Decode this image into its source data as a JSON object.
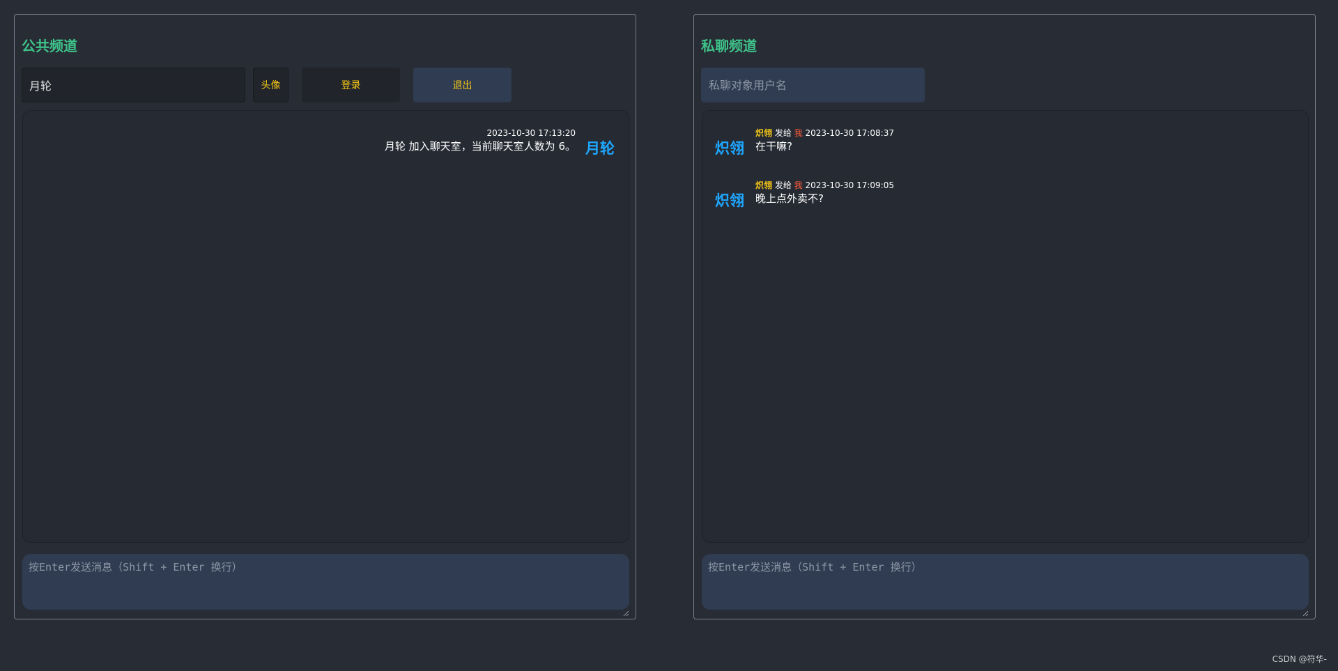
{
  "public_channel": {
    "title": "公共频道",
    "username_value": "月轮",
    "avatar_button": "头像",
    "login_button": "登录",
    "logout_button": "退出",
    "messages": [
      {
        "time": "2023-10-30 17:13:20",
        "text": "月轮 加入聊天室，当前聊天室人数为 6。",
        "avatar": "月轮"
      }
    ],
    "compose_placeholder": "按Enter发送消息（Shift + Enter 换行）"
  },
  "private_channel": {
    "title": "私聊频道",
    "recipient_placeholder": "私聊对象用户名",
    "messages": [
      {
        "avatar": "炽翎",
        "sender": "炽翎",
        "send_to_label": "发给",
        "recipient": "我",
        "time": "2023-10-30 17:08:37",
        "text": "在干嘛?"
      },
      {
        "avatar": "炽翎",
        "sender": "炽翎",
        "send_to_label": "发给",
        "recipient": "我",
        "time": "2023-10-30 17:09:05",
        "text": "晚上点外卖不?"
      }
    ],
    "compose_placeholder": "按Enter发送消息（Shift + Enter 换行）"
  },
  "footer": {
    "watermark": "CSDN @符华-"
  },
  "colors": {
    "background": "#282c34",
    "title_green": "#3ec28a",
    "button_gold": "#f3c616",
    "avatar_blue": "#1ea7ff",
    "recipient_red": "#ff5a3a"
  }
}
